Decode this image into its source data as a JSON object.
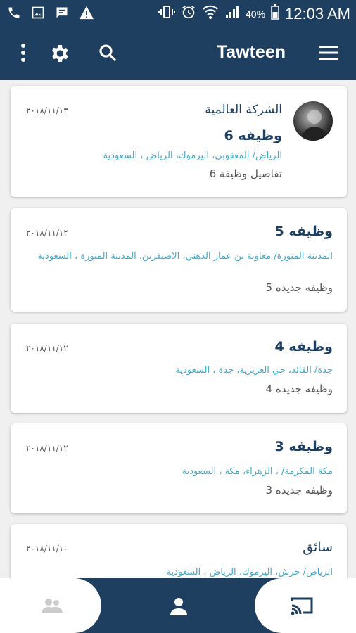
{
  "status_bar": {
    "time": "12:03 AM",
    "battery_percent": "40%",
    "left_icons": [
      "phone-icon",
      "image-icon",
      "message-icon",
      "warning-icon"
    ],
    "right_icons": [
      "vibrate-icon",
      "alarm-icon",
      "wifi-icon",
      "signal-icon",
      "battery-icon"
    ]
  },
  "app_bar": {
    "title": "Tawteen",
    "icons": [
      "more-vertical-icon",
      "gear-icon",
      "search-icon",
      "menu-icon"
    ]
  },
  "jobs": [
    {
      "company": "الشركة العالمية",
      "title": "وظيفه 6",
      "location": "الرياض/ المعقوبي، اليرموك، الرياض ، السعودية",
      "description": "تفاصيل وظيفة 6",
      "date": "٢٠١٨/١١/١٣",
      "has_avatar": true
    },
    {
      "company": "",
      "title": "وظيفه 5",
      "location": "المدينة المنورة/ معاوية بن عمار الدهني، الاصيفرين، المدينة المنورة ، السعودية",
      "description": "وظيفه جديده 5",
      "date": "٢٠١٨/١١/١٢",
      "has_avatar": false
    },
    {
      "company": "",
      "title": "وظيفه 4",
      "location": "جدة/ القائد، حي العزيزية، جدة ، السعودية",
      "description": "وظيفه جديده 4",
      "date": "٢٠١٨/١١/١٢",
      "has_avatar": false
    },
    {
      "company": "",
      "title": "وظيفه 3",
      "location": "مكة المكرمة/ ، الزهراء، مكة ، السعودية",
      "description": "وظيفه جديده 3",
      "date": "٢٠١٨/١١/١٢",
      "has_avatar": false
    },
    {
      "company": "",
      "title": "سائق",
      "location": "الرياض/ حرش، اليرموك، الرياض ، السعودية",
      "description": "",
      "date": "٢٠١٨/١١/١٠",
      "has_avatar": false
    }
  ],
  "bottom_nav": {
    "tabs": [
      "people-icon",
      "person-icon",
      "cast-icon"
    ],
    "active_tab": "person-icon"
  },
  "colors": {
    "primary": "#1e3f60",
    "link": "#3da9c9",
    "background": "#f0f0f0"
  }
}
